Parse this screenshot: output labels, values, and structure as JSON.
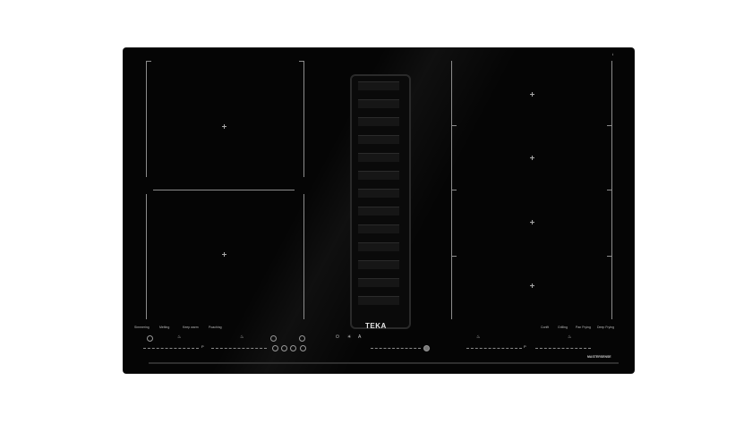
{
  "brand": "TEKA",
  "sub_brand": "MASTERSENSE",
  "cert": "ℹ",
  "left_labels": [
    "Simmering",
    "Melting",
    "Keep warm",
    "Poaching"
  ],
  "right_labels": [
    "Confit",
    "Grilling",
    "Pan Frying",
    "Deep Frying"
  ],
  "left_slider_end": "P",
  "right_slider_end": "P",
  "icons": {
    "power": "power-icon",
    "timer": "timer-icon",
    "lock": "lock-icon",
    "hood_mode": "fan-icon"
  },
  "mini_labels": [
    "",
    "",
    "",
    ""
  ],
  "colors": {
    "glass": "#050505",
    "lines": "#8c8c8c"
  }
}
